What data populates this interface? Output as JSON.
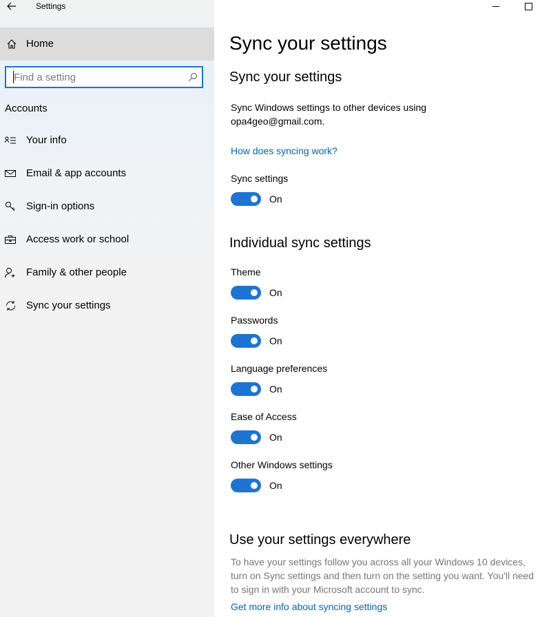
{
  "window": {
    "app_title": "Settings",
    "back_icon": "arrow-left-icon",
    "minimize_icon": "minimize-icon",
    "maximize_icon": "maximize-icon"
  },
  "sidebar": {
    "home_label": "Home",
    "search_placeholder": "Find a setting",
    "section_title": "Accounts",
    "items": [
      {
        "label": "Your info",
        "icon": "person-card-icon"
      },
      {
        "label": "Email & app accounts",
        "icon": "mail-icon"
      },
      {
        "label": "Sign-in options",
        "icon": "key-icon"
      },
      {
        "label": "Access work or school",
        "icon": "briefcase-icon"
      },
      {
        "label": "Family & other people",
        "icon": "person-add-icon"
      },
      {
        "label": "Sync your settings",
        "icon": "sync-icon"
      }
    ]
  },
  "main": {
    "page_title": "Sync your settings",
    "sync_heading": "Sync your settings",
    "sync_desc_line1": "Sync Windows settings to other devices using",
    "sync_desc_line2": "opa4geo@gmail.com.",
    "how_link": "How does syncing work?",
    "sync_settings": {
      "label": "Sync settings",
      "state": "On"
    },
    "individual_heading": "Individual sync settings",
    "toggles": [
      {
        "label": "Theme",
        "state": "On"
      },
      {
        "label": "Passwords",
        "state": "On"
      },
      {
        "label": "Language preferences",
        "state": "On"
      },
      {
        "label": "Ease of Access",
        "state": "On"
      },
      {
        "label": "Other Windows settings",
        "state": "On"
      }
    ],
    "everywhere_heading": "Use your settings everywhere",
    "everywhere_line1": "To have your settings follow you across all your Windows 10 devices,",
    "everywhere_line2": "turn on Sync settings and then turn on the setting you want. You'll need",
    "everywhere_line3": "to sign in with your Microsoft account to sync.",
    "more_info_link": "Get more info about syncing settings"
  },
  "colors": {
    "accent": "#1f74d1",
    "link": "#0063b1",
    "sidebar_bg": "#f2f2f2",
    "home_bg": "#dcdcdc"
  }
}
